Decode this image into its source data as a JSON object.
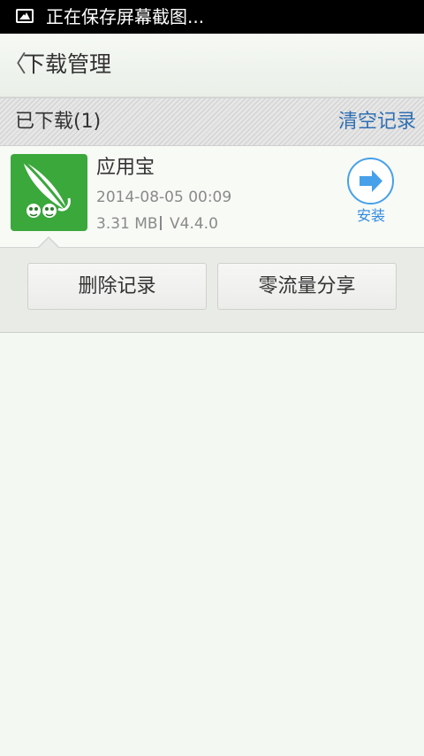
{
  "status_bar": {
    "notification_text": "正在保存屏幕截图..."
  },
  "header": {
    "back_glyph": "〈",
    "title": "下载管理"
  },
  "section": {
    "downloaded_label": "已下载(1)",
    "clear_label": "清空记录"
  },
  "download_item": {
    "name": "应用宝",
    "date": "2014-08-05 00:09",
    "size": "3.31 MB",
    "version": "V4.4.0",
    "install_label": "安装",
    "icon_color": "#3aa83b"
  },
  "actions": {
    "delete_label": "删除记录",
    "share_label": "零流量分享"
  },
  "colors": {
    "accent_blue": "#2f6fb3",
    "install_blue": "#47a0ea",
    "background": "#f4f8f2"
  }
}
